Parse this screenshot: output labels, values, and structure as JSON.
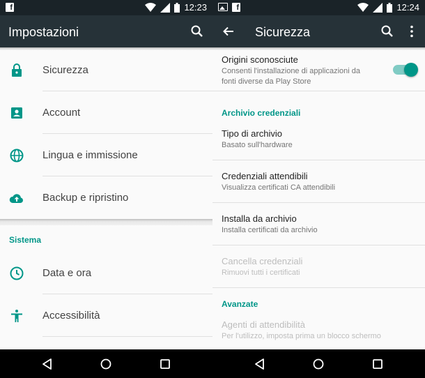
{
  "left": {
    "status": {
      "time": "12:23"
    },
    "toolbar": {
      "title": "Impostazioni"
    },
    "items": [
      {
        "label": "Sicurezza",
        "icon": "lock-icon"
      },
      {
        "label": "Account",
        "icon": "account-box-icon"
      },
      {
        "label": "Lingua e immissione",
        "icon": "globe-icon"
      },
      {
        "label": "Backup e ripristino",
        "icon": "cloud-upload-icon"
      }
    ],
    "section_sistema": "Sistema",
    "sistema_items": [
      {
        "label": "Data e ora",
        "icon": "clock-icon"
      },
      {
        "label": "Accessibilità",
        "icon": "accessibility-icon"
      }
    ]
  },
  "right": {
    "status": {
      "time": "12:24"
    },
    "toolbar": {
      "title": "Sicurezza"
    },
    "origini": {
      "title": "Origini sconosciute",
      "subtitle_line1": "Consenti l'installazione di applicazioni da",
      "subtitle_line2": "fonti diverse da Play Store",
      "enabled": true
    },
    "section_archivio": "Archivio credenziali",
    "tipo": {
      "title": "Tipo di archivio",
      "subtitle": "Basato sull'hardware"
    },
    "credenziali": {
      "title": "Credenziali attendibili",
      "subtitle": "Visualizza certificati CA attendibili"
    },
    "installa": {
      "title": "Installa da archivio",
      "subtitle": "Installa certificati da archivio"
    },
    "cancella": {
      "title": "Cancella credenziali",
      "subtitle": "Rimuovi tutti i certificati"
    },
    "section_avanzate": "Avanzate",
    "agenti": {
      "title": "Agenti di attendibilità",
      "subtitle": "Per l'utilizzo, imposta prima un blocco schermo"
    }
  },
  "colors": {
    "accent": "#009688",
    "toolbar": "#263238",
    "statusbar": "#1a2328"
  }
}
